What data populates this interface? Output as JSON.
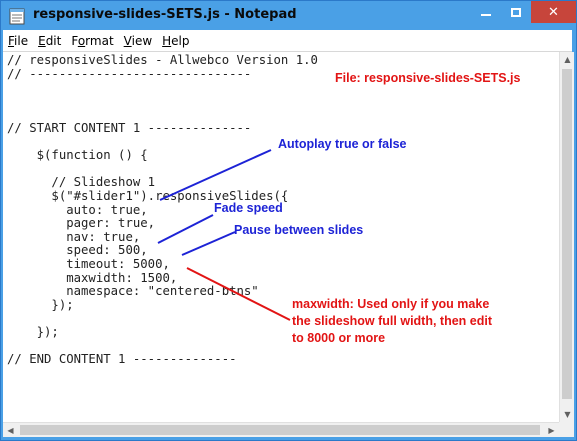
{
  "window": {
    "title": "responsive-slides-SETS.js - Notepad",
    "icon": "notepad-icon",
    "controls": {
      "minimize": "",
      "maximize": "",
      "close": "✕"
    }
  },
  "menu": {
    "file": {
      "accel": "F",
      "rest": "ile"
    },
    "edit": {
      "accel": "E",
      "rest": "dit"
    },
    "format": {
      "pre": "F",
      "accel": "o",
      "rest": "rmat"
    },
    "view": {
      "accel": "V",
      "rest": "iew"
    },
    "help": {
      "accel": "H",
      "rest": "elp"
    }
  },
  "code": "// responsiveSlides - Allwebco Version 1.0\n// ------------------------------\n\n\n\n// START CONTENT 1 --------------\n\n    $(function () {\n\n      // Slideshow 1\n      $(\"#slider1\").responsiveSlides({\n        auto: true,\n        pager: true,\n        nav: true,\n        speed: 500,\n        timeout: 5000,\n        maxwidth: 1500,\n        namespace: \"centered-btns\"\n      });\n\n    });\n\n// END CONTENT 1 --------------",
  "annotations": {
    "file_label": "File: responsive-slides-SETS.js",
    "autoplay": "Autoplay true or false",
    "fade_speed": "Fade speed",
    "pause": "Pause between slides",
    "maxwidth_note": "maxwidth: Used only if you make the slideshow full width, then edit to 8000 or more"
  },
  "colors": {
    "titlebar": "#4aa0e6",
    "annotation_blue": "#1d23d6",
    "annotation_red": "#e21414",
    "close_button": "#c7453b"
  }
}
